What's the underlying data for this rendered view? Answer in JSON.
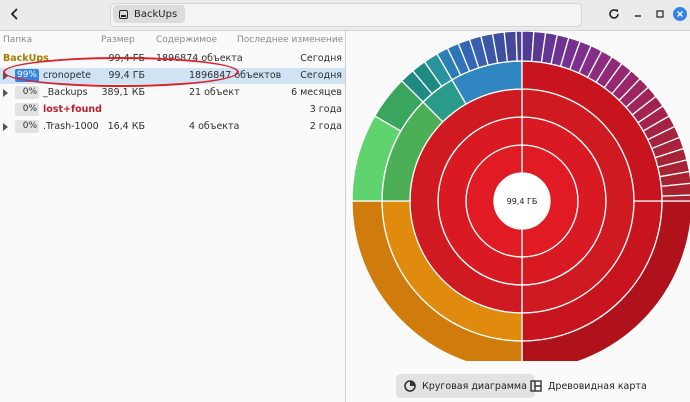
{
  "header": {
    "back_label": "",
    "location": "BackUps"
  },
  "columns": {
    "folder": "Папка",
    "size": "Размер",
    "contents": "Содержимое",
    "modified": "Последнее изменение"
  },
  "root": {
    "name": "BackUps",
    "size": "99,4 ГБ",
    "contents": "1896874 объекта",
    "modified": "Сегодня"
  },
  "rows": [
    {
      "pct": "99%",
      "pct_value": 99,
      "name": "cronopete",
      "size": "99,4 ГБ",
      "contents": "1896847 объектов",
      "modified": "Сегодня",
      "selected": true,
      "expander": true,
      "name_color": "#2e2e2e"
    },
    {
      "pct": "0%",
      "pct_value": 0,
      "name": "_Backups",
      "size": "389,1 КБ",
      "contents": "21 объект",
      "modified": "6 месяцев",
      "selected": false,
      "expander": true,
      "name_color": "#2e2e2e"
    },
    {
      "pct": "0%",
      "pct_value": 0,
      "name": "lost+found",
      "size": "",
      "contents": "",
      "modified": "3 года",
      "selected": false,
      "expander": false,
      "name_color": "#c01c28"
    },
    {
      "pct": "0%",
      "pct_value": 0,
      "name": ".Trash-1000",
      "size": "16,4 КБ",
      "contents": "4 объекта",
      "modified": "2 года",
      "selected": false,
      "expander": true,
      "name_color": "#2e2e2e"
    }
  ],
  "chart": {
    "center_label": "99,4 ГБ"
  },
  "view_buttons": {
    "pie": "Круговая диаграмма",
    "tree": "Древовидная карта"
  },
  "colors": {
    "accent": "#3584e4",
    "root_folder": "#a67c00",
    "highlight": "#d8232a"
  }
}
